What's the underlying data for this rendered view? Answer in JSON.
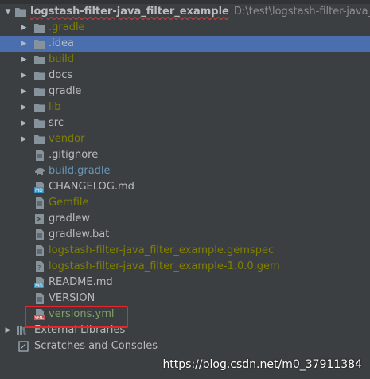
{
  "tree": {
    "root": {
      "name": "logstash-filter-java_filter_example",
      "path": "D:\\test\\logstash-filter-java_filter_exa"
    },
    "items": [
      {
        "label": ".gradle",
        "kind": "folder",
        "expandable": true,
        "color": "olive",
        "icon": "folder-icon",
        "selected": false
      },
      {
        "label": ".idea",
        "kind": "folder",
        "expandable": true,
        "color": "default",
        "icon": "folder-icon",
        "selected": true
      },
      {
        "label": "build",
        "kind": "folder",
        "expandable": true,
        "color": "olive",
        "icon": "folder-icon",
        "selected": false
      },
      {
        "label": "docs",
        "kind": "folder",
        "expandable": true,
        "color": "default",
        "icon": "folder-icon",
        "selected": false
      },
      {
        "label": "gradle",
        "kind": "folder",
        "expandable": true,
        "color": "default",
        "icon": "folder-icon",
        "selected": false
      },
      {
        "label": "lib",
        "kind": "folder",
        "expandable": true,
        "color": "olive",
        "icon": "folder-icon",
        "selected": false
      },
      {
        "label": "src",
        "kind": "folder",
        "expandable": true,
        "color": "default",
        "icon": "folder-icon",
        "selected": false
      },
      {
        "label": "vendor",
        "kind": "folder",
        "expandable": true,
        "color": "olive",
        "icon": "folder-icon",
        "selected": false
      },
      {
        "label": ".gitignore",
        "kind": "file",
        "expandable": false,
        "color": "default",
        "icon": "text-file-icon",
        "selected": false
      },
      {
        "label": "build.gradle",
        "kind": "file",
        "expandable": false,
        "color": "blue",
        "icon": "gradle-elephant-icon",
        "selected": false
      },
      {
        "label": "CHANGELOG.md",
        "kind": "file",
        "expandable": false,
        "color": "default",
        "icon": "markdown-file-icon",
        "selected": false
      },
      {
        "label": "Gemfile",
        "kind": "file",
        "expandable": false,
        "color": "olive",
        "icon": "text-file-icon",
        "selected": false
      },
      {
        "label": "gradlew",
        "kind": "file",
        "expandable": false,
        "color": "default",
        "icon": "shell-file-icon",
        "selected": false
      },
      {
        "label": "gradlew.bat",
        "kind": "file",
        "expandable": false,
        "color": "default",
        "icon": "text-file-icon",
        "selected": false
      },
      {
        "label": "logstash-filter-java_filter_example.gemspec",
        "kind": "file",
        "expandable": false,
        "color": "olive",
        "icon": "text-file-icon",
        "selected": false
      },
      {
        "label": "logstash-filter-java_filter_example-1.0.0.gem",
        "kind": "file",
        "expandable": false,
        "color": "olive",
        "icon": "unknown-file-icon",
        "selected": false
      },
      {
        "label": "README.md",
        "kind": "file",
        "expandable": false,
        "color": "default",
        "icon": "markdown-file-icon",
        "selected": false
      },
      {
        "label": "VERSION",
        "kind": "file",
        "expandable": false,
        "color": "default",
        "icon": "text-file-icon",
        "selected": false
      },
      {
        "label": "versions.yml",
        "kind": "file",
        "expandable": false,
        "color": "excluded",
        "icon": "yaml-file-icon",
        "selected": false
      }
    ],
    "external_libraries": "External Libraries",
    "scratches": "Scratches and Consoles"
  },
  "colors": {
    "default": "#bbbbbb",
    "olive": "#808000",
    "blue": "#6897bb",
    "excluded": "#7fa06a",
    "selection": "#4b6eaf",
    "highlight_box": "#e8262a"
  },
  "watermark": "https://blog.csdn.net/m0_37911384"
}
